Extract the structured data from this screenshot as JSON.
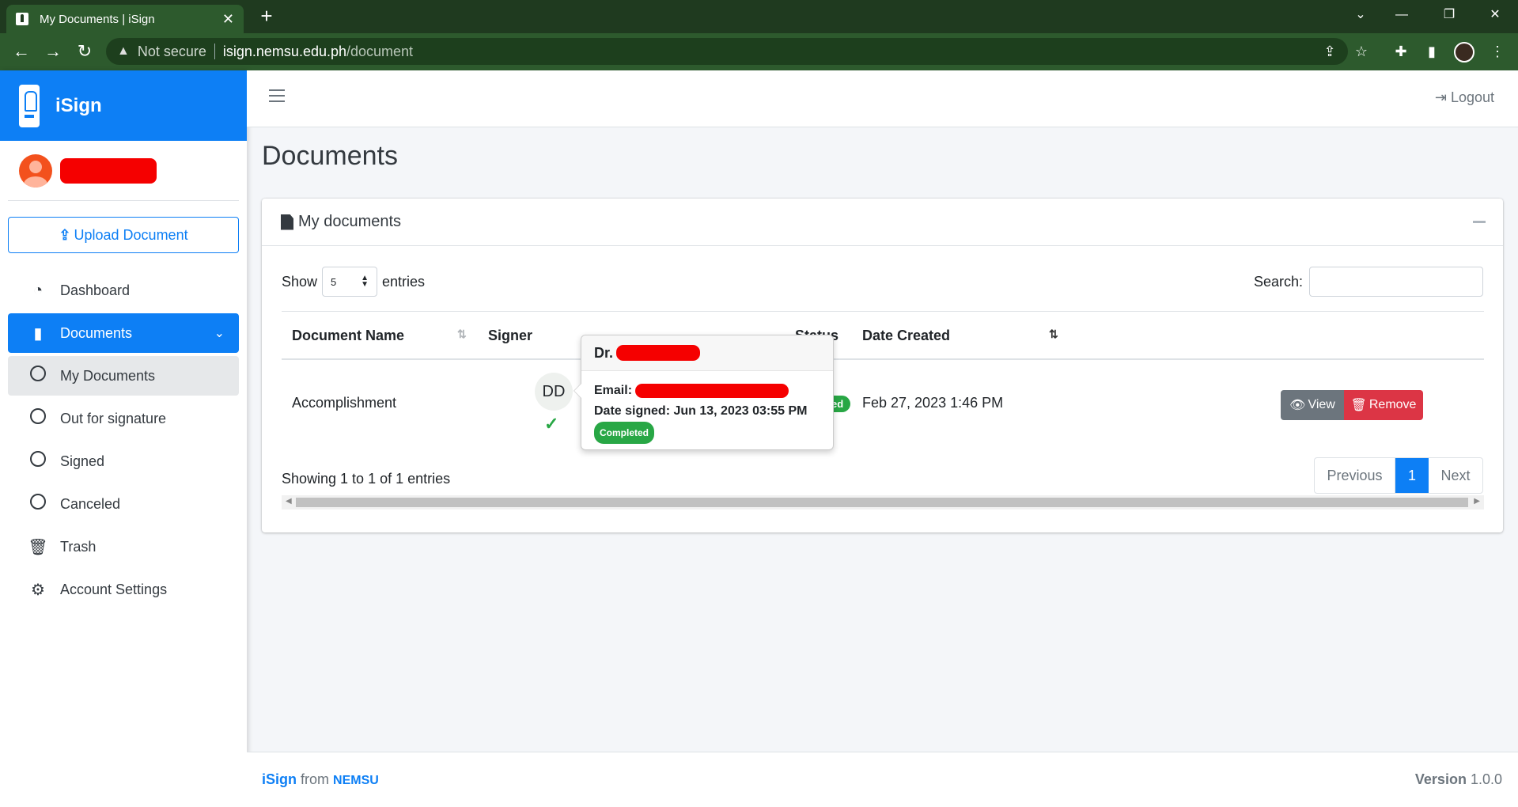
{
  "browser": {
    "tab_title": "My Documents | iSign",
    "not_secure": "Not secure",
    "url_host": "isign.nemsu.edu.ph",
    "url_path": "/document"
  },
  "sidebar": {
    "brand": "iSign",
    "upload_label": "Upload Document",
    "items": [
      {
        "label": "Dashboard",
        "icon": "dashboard-icon"
      },
      {
        "label": "Documents",
        "icon": "file-icon"
      },
      {
        "label": "My Documents",
        "icon": "circle-icon"
      },
      {
        "label": "Out for signature",
        "icon": "circle-icon"
      },
      {
        "label": "Signed",
        "icon": "circle-icon"
      },
      {
        "label": "Canceled",
        "icon": "circle-icon"
      },
      {
        "label": "Trash",
        "icon": "trash-icon"
      },
      {
        "label": "Account Settings",
        "icon": "gear-icon"
      }
    ]
  },
  "topbar": {
    "logout_label": "Logout"
  },
  "page": {
    "title": "Documents"
  },
  "card": {
    "title": "My documents",
    "show_label": "Show",
    "entries_value": "5",
    "entries_label": "entries",
    "search_label": "Search:",
    "search_value": "",
    "columns": [
      "Document Name",
      "Signer",
      "Status",
      "Date Created"
    ],
    "rows": [
      {
        "name": "Accomplishment",
        "signer_initials": "DD",
        "status": "Completed",
        "date_created": "Feb 27, 2023 1:46 PM",
        "view_label": "View",
        "remove_label": "Remove"
      }
    ],
    "info": "Showing 1 to 1 of 1 entries",
    "pagination": {
      "previous": "Previous",
      "current": "1",
      "next": "Next"
    }
  },
  "popover": {
    "title_prefix": "Dr.",
    "email_label": "Email:",
    "date_signed": "Date signed: Jun 13, 2023 03:55 PM",
    "status": "Completed"
  },
  "footer": {
    "brand": "iSign",
    "from": "from",
    "org": "NEMSU",
    "version_label": "Version",
    "version": "1.0.0"
  },
  "colors": {
    "primary": "#0d7ff5",
    "success": "#28a745",
    "danger": "#dc3545",
    "secondary": "#6c757d",
    "redaction": "#f50000"
  }
}
